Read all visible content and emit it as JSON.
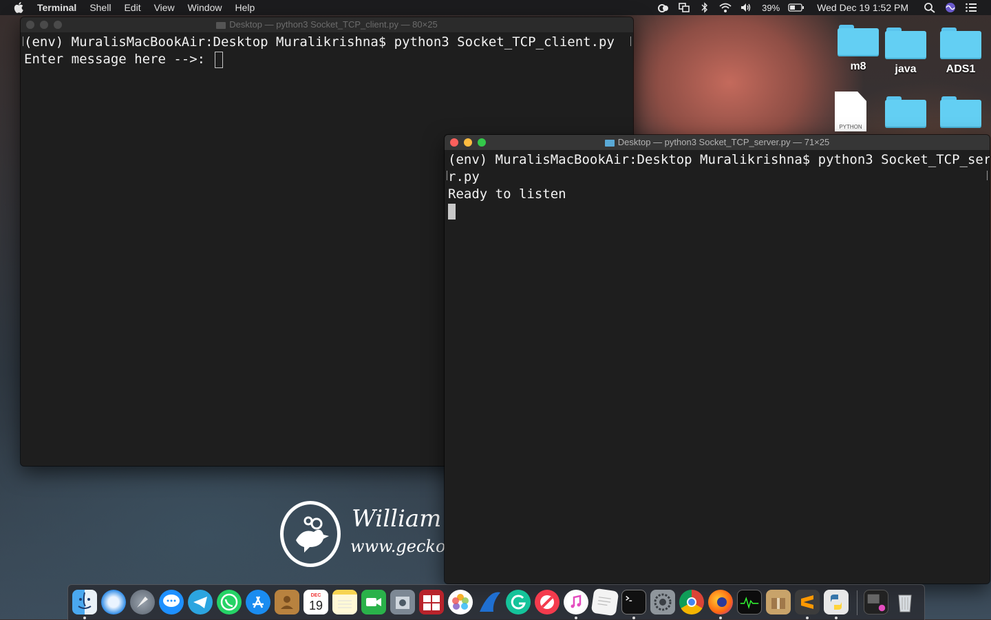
{
  "menubar": {
    "app": "Terminal",
    "items": [
      "Shell",
      "Edit",
      "View",
      "Window",
      "Help"
    ],
    "battery": "39%",
    "datetime": "Wed Dec 19  1:52 PM"
  },
  "desktop": {
    "items": [
      {
        "label": "m8",
        "icon": "folder-icon"
      },
      {
        "label": "java",
        "icon": "folder-icon"
      },
      {
        "label": "ADS1",
        "icon": "folder-icon"
      },
      {
        "label": "",
        "icon": "python-file-icon",
        "badge": "PYTHON"
      },
      {
        "label": "",
        "icon": "folder-icon"
      },
      {
        "label": "",
        "icon": "folder-icon"
      }
    ]
  },
  "watermark": {
    "name": "William W",
    "url": "www.geckoa"
  },
  "client_window": {
    "title": "Desktop — python3 Socket_TCP_client.py — 80×25",
    "lines": [
      "(env) MuralisMacBookAir:Desktop Muralikrishna$ python3 Socket_TCP_client.py",
      "Enter message here -->: "
    ]
  },
  "server_window": {
    "title": "Desktop — python3 Socket_TCP_server.py — 71×25",
    "lines": [
      "(env) MuralisMacBookAir:Desktop Muralikrishna$ python3 Socket_TCP_serve",
      "r.py",
      "Ready to listen"
    ]
  },
  "dock": {
    "apps": [
      "Finder",
      "Safari",
      "Launchpad",
      "Messages",
      "Telegram",
      "WhatsApp",
      "App Store",
      "Contacts",
      "Calendar",
      "Notes",
      "FaceTime",
      "Preview",
      "Photo Booth",
      "Photos",
      "Wireshark",
      "Grammarly",
      "News",
      "iTunes",
      "TextEdit",
      "Terminal",
      "System Preferences",
      "Chrome",
      "Firefox",
      "Activity Monitor",
      "Archive Utility",
      "Sublime Text",
      "Python Launcher",
      "Downloads",
      "Trash"
    ],
    "calendar_month": "DEC",
    "calendar_day": "19"
  }
}
